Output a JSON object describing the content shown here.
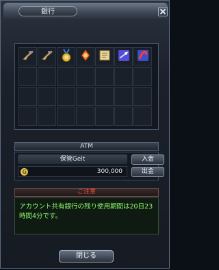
{
  "window": {
    "title": "銀行"
  },
  "inventory": {
    "items": [
      {
        "icon": "flintlock-pistol-icon"
      },
      {
        "icon": "flintlock-pistol-icon"
      },
      {
        "icon": "gold-medal-icon"
      },
      {
        "icon": "orb-gem-icon"
      },
      {
        "icon": "scroll-icon"
      },
      {
        "icon": "magic-card-icon"
      },
      {
        "icon": "red-card-icon"
      }
    ]
  },
  "atm": {
    "header": "ATM",
    "account_label": "保管Gelt",
    "currency_symbol": "G",
    "amount": "300,000",
    "deposit_label": "入金",
    "withdraw_label": "出金"
  },
  "notice": {
    "header": "ご注意",
    "message": "アカウント共有銀行の残り使用期間は20日23時間4分です。"
  },
  "footer": {
    "close_label": "閉じる"
  }
}
